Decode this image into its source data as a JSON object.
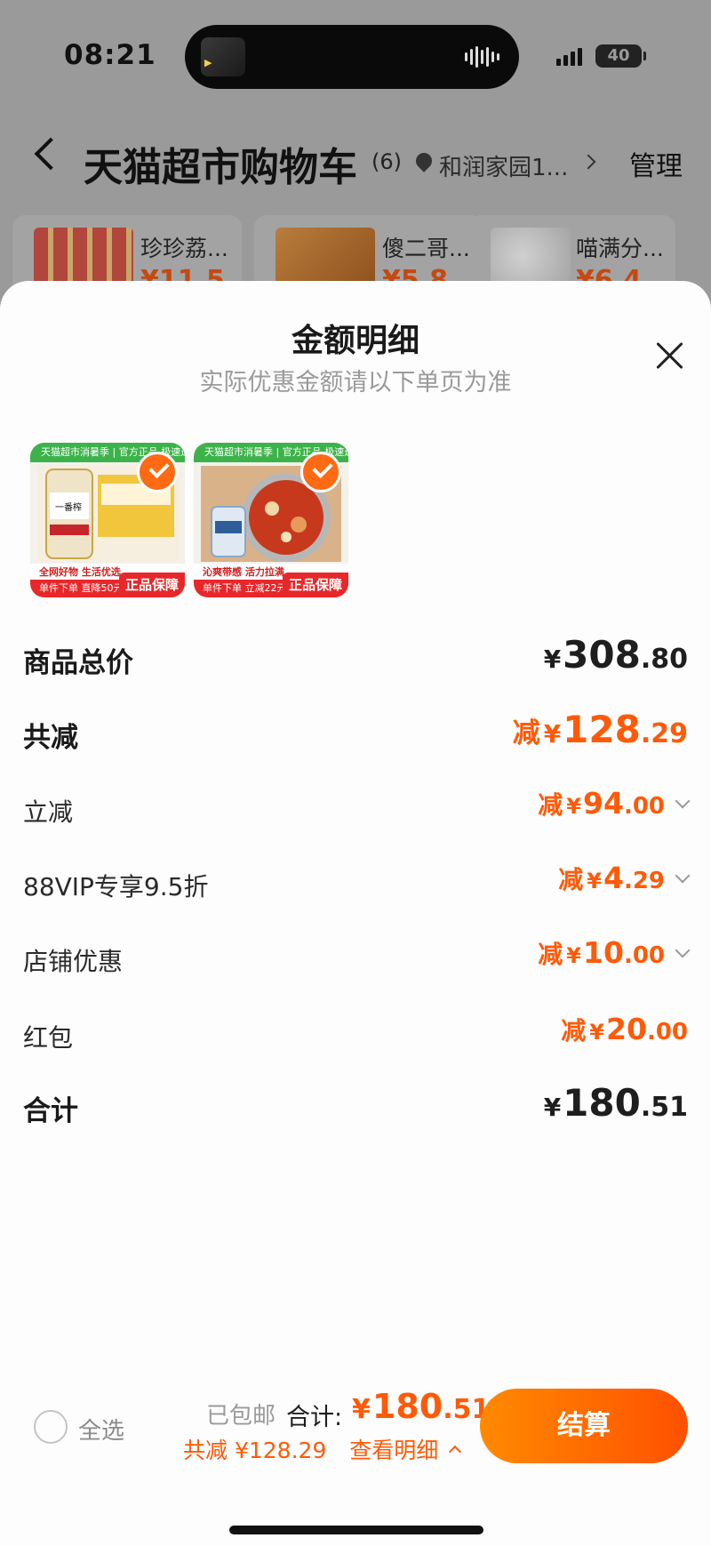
{
  "status_bar": {
    "time": "08:21",
    "battery": "40"
  },
  "nav": {
    "title": "天猫超市购物车",
    "count": "(6)",
    "address": "和润家园1...",
    "manage": "管理"
  },
  "bg_items": [
    {
      "name": "珍珍荔...",
      "price": "¥11.5"
    },
    {
      "name": "傻二哥...",
      "price": "¥5.8"
    },
    {
      "name": "喵满分...",
      "price": "¥6.4"
    }
  ],
  "sheet": {
    "title": "金额明细",
    "subtitle": "实际优惠金额请以下单页为准"
  },
  "products": [
    {
      "top_text": "天猫超市消暑季 | 官方正品 极速送达",
      "line1": "全网好物 生活优选",
      "line2": "单件下单 直降50元",
      "badge": "正品保障"
    },
    {
      "top_text": "天猫超市消暑季 | 官方正品 极速送达",
      "line1": "沁爽带感 活力拉满",
      "line2": "单件下单 立减22元",
      "badge": "正品保障"
    }
  ],
  "rows": [
    {
      "label": "商品总价",
      "prefix": "",
      "yen": "¥",
      "int": "308",
      "dec": ".80",
      "color": "black",
      "bold": true,
      "expandable": false
    },
    {
      "label": "共减",
      "prefix": "减",
      "yen": "¥",
      "int": "128",
      "dec": ".29",
      "color": "orange",
      "bold": true,
      "expandable": false
    },
    {
      "label": "立减",
      "prefix": "减",
      "yen": "¥",
      "int": "94",
      "dec": ".00",
      "color": "orange",
      "bold": false,
      "expandable": true
    },
    {
      "label": "88VIP专享9.5折",
      "prefix": "减",
      "yen": "¥",
      "int": "4",
      "dec": ".29",
      "color": "orange",
      "bold": false,
      "expandable": true
    },
    {
      "label": "店铺优惠",
      "prefix": "减",
      "yen": "¥",
      "int": "10",
      "dec": ".00",
      "color": "orange",
      "bold": false,
      "expandable": true
    },
    {
      "label": "红包",
      "prefix": "减",
      "yen": "¥",
      "int": "20",
      "dec": ".00",
      "color": "orange",
      "bold": false,
      "expandable": false
    },
    {
      "label": "合计",
      "prefix": "",
      "yen": "¥",
      "int": "180",
      "dec": ".51",
      "color": "black",
      "bold": true,
      "expandable": false
    }
  ],
  "footer": {
    "select_all": "全选",
    "shipping": "已包邮",
    "total_label": "合计:",
    "total_yen": "¥",
    "total_int": "180",
    "total_dec": ".51",
    "saved_label": "共减",
    "saved_amount": "¥128.29",
    "detail_link": "查看明细",
    "checkout": "结算"
  },
  "colors": {
    "accent": "#ff5a08",
    "checkout_start": "#ff8a00",
    "checkout_end": "#ff5000"
  }
}
